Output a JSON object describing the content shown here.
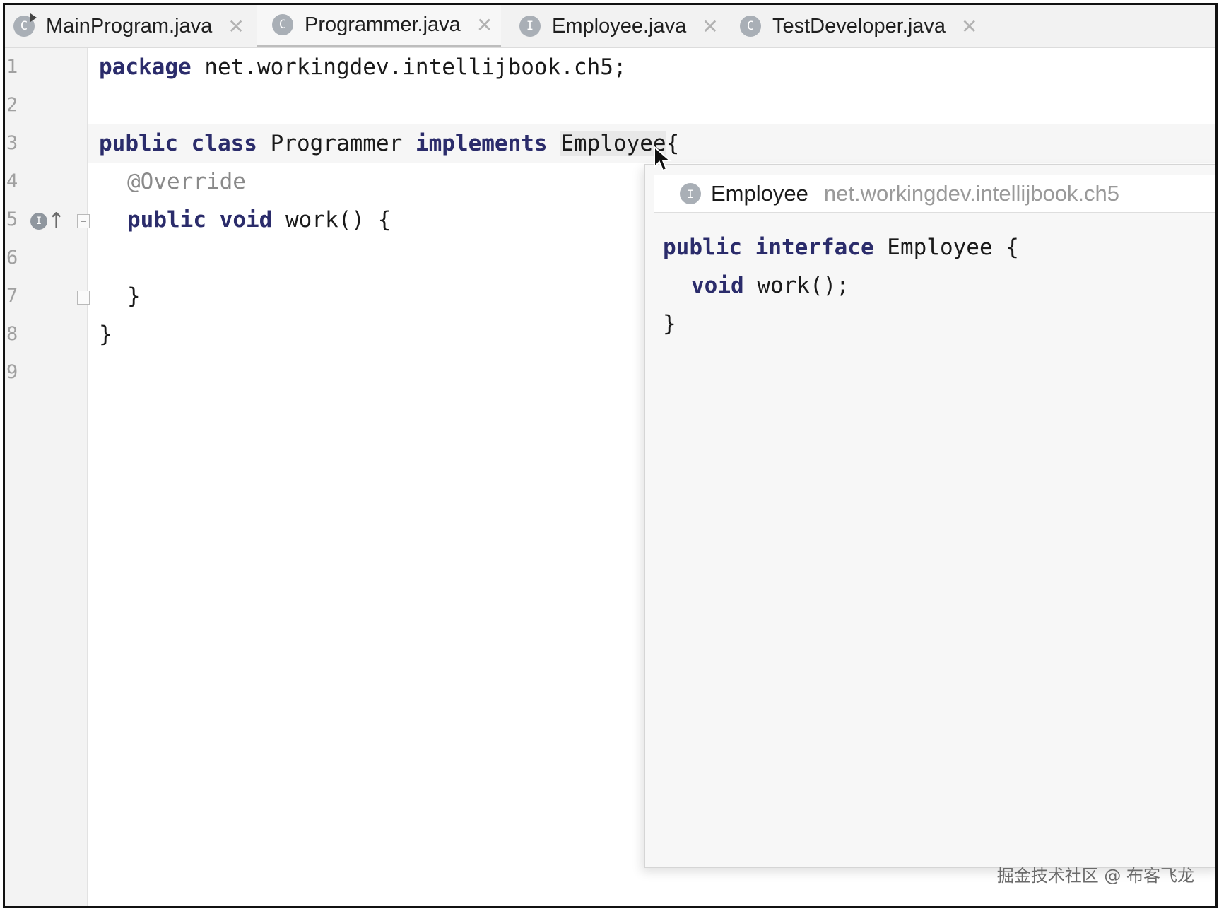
{
  "tabs": [
    {
      "icon": "C",
      "label": "MainProgram.java",
      "close": "✕"
    },
    {
      "icon": "C",
      "label": "Programmer.java",
      "close": "✕"
    },
    {
      "icon": "I",
      "label": "Employee.java",
      "close": "✕"
    },
    {
      "icon": "C",
      "label": "TestDeveloper.java",
      "close": "✕"
    }
  ],
  "gutter": {
    "line_numbers": [
      "1",
      "2",
      "3",
      "4",
      "5",
      "6",
      "7",
      "8",
      "9"
    ],
    "implements_icon_letter": "I"
  },
  "code": {
    "l1_kw": "package",
    "l1_rest": " net.workingdev.intellijbook.ch5;",
    "l3_kw1": "public",
    "l3_kw2": "class",
    "l3_name": " Programmer ",
    "l3_kw3": "implements",
    "l3_ref": "Employee",
    "l3_brace": "{",
    "l4_ann": "@Override",
    "l5_kw1": "public",
    "l5_kw2": "void",
    "l5_rest": " work() {",
    "l7": "}",
    "l8": "}"
  },
  "popup": {
    "icon": "I",
    "name": "Employee",
    "package": "net.workingdev.intellijbook.ch5",
    "p1_kw1": "public",
    "p1_kw2": "interface",
    "p1_rest": " Employee {",
    "p2_kw": "void",
    "p2_rest": " work();",
    "p3": "}"
  },
  "watermark": "掘金技术社区 @ 布客飞龙"
}
